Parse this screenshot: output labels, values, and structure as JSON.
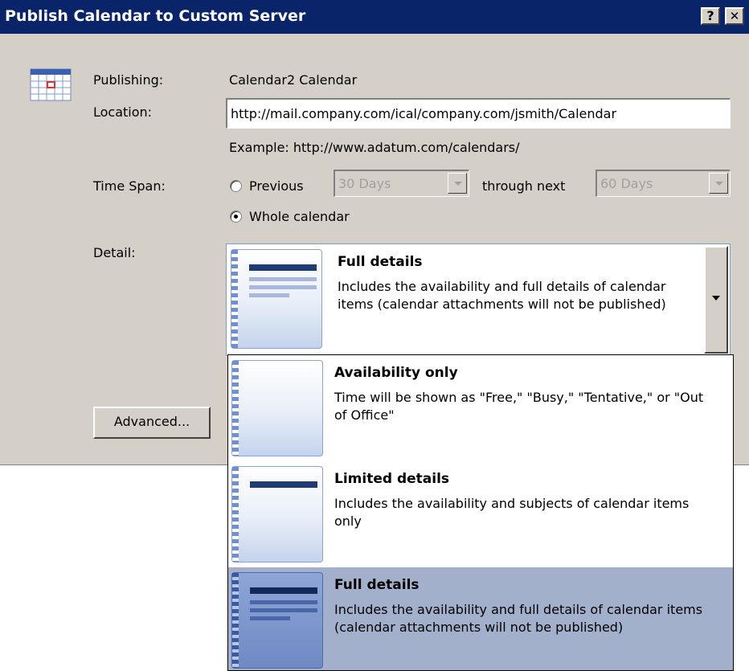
{
  "window": {
    "title": "Publish Calendar to Custom Server",
    "help_label": "?",
    "close_label": "✕"
  },
  "form": {
    "publishing_label": "Publishing:",
    "publishing_value": "Calendar2 Calendar",
    "location_label": "Location:",
    "location_value": "http://mail.company.com/ical/company.com/jsmith/Calendar",
    "example_text": "Example: http://www.adatum.com/calendars/",
    "timespan_label": "Time Span:",
    "previous_label": "Previous",
    "previous_value": "30 Days",
    "through_next_label": "through next",
    "next_value": "60 Days",
    "whole_calendar_label": "Whole calendar",
    "detail_label": "Detail:",
    "detail_selected_title": "Full details",
    "detail_selected_desc": "Includes the availability and full details of calendar items (calendar attachments will not be published)",
    "advanced_button": "Advanced..."
  },
  "dropdown": {
    "items": [
      {
        "title": "Availability only",
        "desc": "Time will be shown as \"Free,\" \"Busy,\" \"Tentative,\" or \"Out of Office\""
      },
      {
        "title": "Limited details",
        "desc": "Includes the availability and subjects of calendar items only"
      },
      {
        "title": "Full details",
        "desc": "Includes the availability and full details of calendar items (calendar attachments will not be published)"
      }
    ]
  },
  "colors": {
    "title_bar": "#0a246a",
    "dialog_bg": "#d4d0c8",
    "selected_item_bg": "#a3b0cc"
  }
}
